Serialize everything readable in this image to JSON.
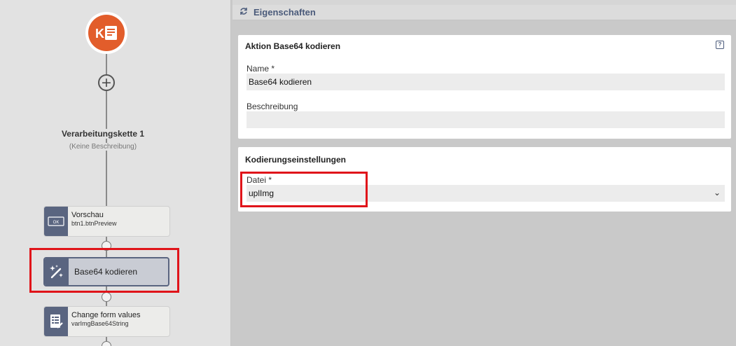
{
  "flow": {
    "chain_title": "Verarbeitungskette 1",
    "chain_description": "(Keine Beschreibung)",
    "actions": [
      {
        "title": "Vorschau",
        "subtitle": "btn1.btnPreview",
        "icon": "ok-button-icon",
        "icon_text": "OK"
      },
      {
        "title": "Base64 kodieren",
        "subtitle": "",
        "icon": "magic-wand-icon"
      },
      {
        "title": "Change form values",
        "subtitle": "varImgBase64String",
        "icon": "form-edit-icon"
      }
    ]
  },
  "properties": {
    "header_title": "Eigenschaften",
    "action_card": {
      "title": "Aktion Base64 kodieren",
      "name_label": "Name",
      "required_mark": "*",
      "name_value": "Base64 kodieren",
      "description_label": "Beschreibung",
      "description_value": ""
    },
    "encoding_card": {
      "title": "Kodierungseinstellungen",
      "file_label": "Datei",
      "required_mark": "*",
      "file_value": "uplImg"
    }
  },
  "colors": {
    "accent": "#4a5a7a",
    "start_node": "#e25d2b",
    "highlight": "#e0141a",
    "icon_bg": "#5a6580"
  }
}
